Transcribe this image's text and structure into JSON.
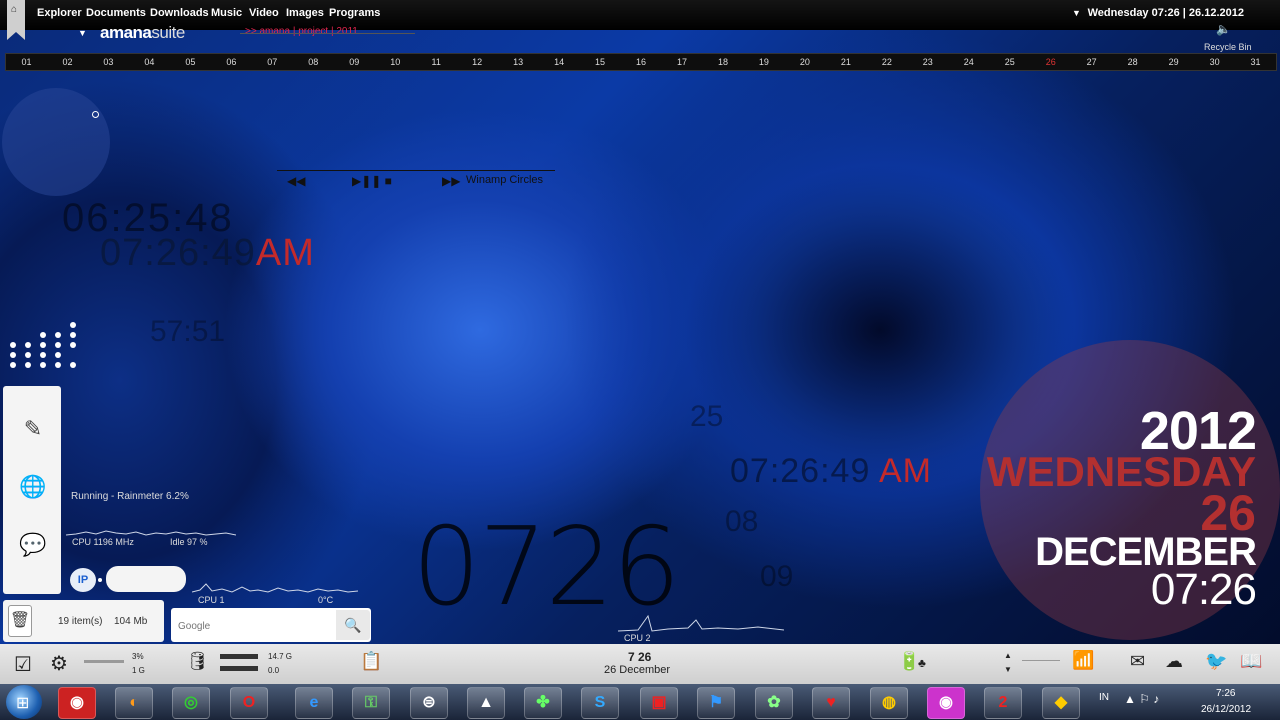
{
  "topbar": {
    "menu": [
      "Explorer",
      "Documents",
      "Downloads",
      "Music",
      "Video",
      "Images",
      "Programs"
    ],
    "datetime": "Wednesday 07:26 | 26.12.2012",
    "recycle_label": "Recycle Bin"
  },
  "brand": {
    "bold": "amana",
    "light": "suite",
    "project": ">> amana | project | 2011"
  },
  "days": [
    "01",
    "02",
    "03",
    "04",
    "05",
    "06",
    "07",
    "08",
    "09",
    "10",
    "11",
    "12",
    "13",
    "14",
    "15",
    "16",
    "17",
    "18",
    "19",
    "20",
    "21",
    "22",
    "23",
    "24",
    "25",
    "26",
    "27",
    "28",
    "29",
    "30",
    "31"
  ],
  "today": "26",
  "clock": {
    "ghost": "06:25:48",
    "main": "07:26:49",
    "ampm": "AM",
    "ghost2": "57:51"
  },
  "system": {
    "running": "Running - Rainmeter 6.2%",
    "cpu_mhz": "CPU 1196 MHz",
    "idle": "Idle 97 %",
    "ip_label": "IP",
    "cpu1": "CPU 1",
    "cpu_temp": "0°C",
    "cpu2": "CPU 2"
  },
  "recycle": {
    "items": "19 item(s)",
    "size": "104 Mb"
  },
  "search": {
    "placeholder": "Google"
  },
  "winamp": {
    "title": "Winamp Circles"
  },
  "bigclock": "0726",
  "ghost_mid": {
    "time": "07:26:49",
    "ampm": "AM"
  },
  "date_widget": {
    "year": "2012",
    "weekday": "WEDNESDAY",
    "day": "26",
    "month": "DECEMBER",
    "time": "07:26"
  },
  "bottombar": {
    "cpu_pct": "3%",
    "mem": "1 G",
    "disk_total": "14.7 G",
    "disk_used": "0.0",
    "time": "7 26",
    "date": "26 December"
  },
  "taskbar": {
    "lang": "IN",
    "time": "7:26",
    "date": "26/12/2012",
    "apps": [
      "CCleaner",
      "Firefox",
      "Chrome",
      "Opera",
      "Internet Explorer",
      "Keys",
      "Steam",
      "Aimp",
      "Clover",
      "Skype",
      "Task",
      "Flag",
      "Gallery",
      "Heart",
      "Rocket",
      "Wallpaper",
      "Counter",
      "Games"
    ]
  },
  "colors": {
    "accent": "#c42a2a",
    "project_pink": "#e0264f"
  }
}
